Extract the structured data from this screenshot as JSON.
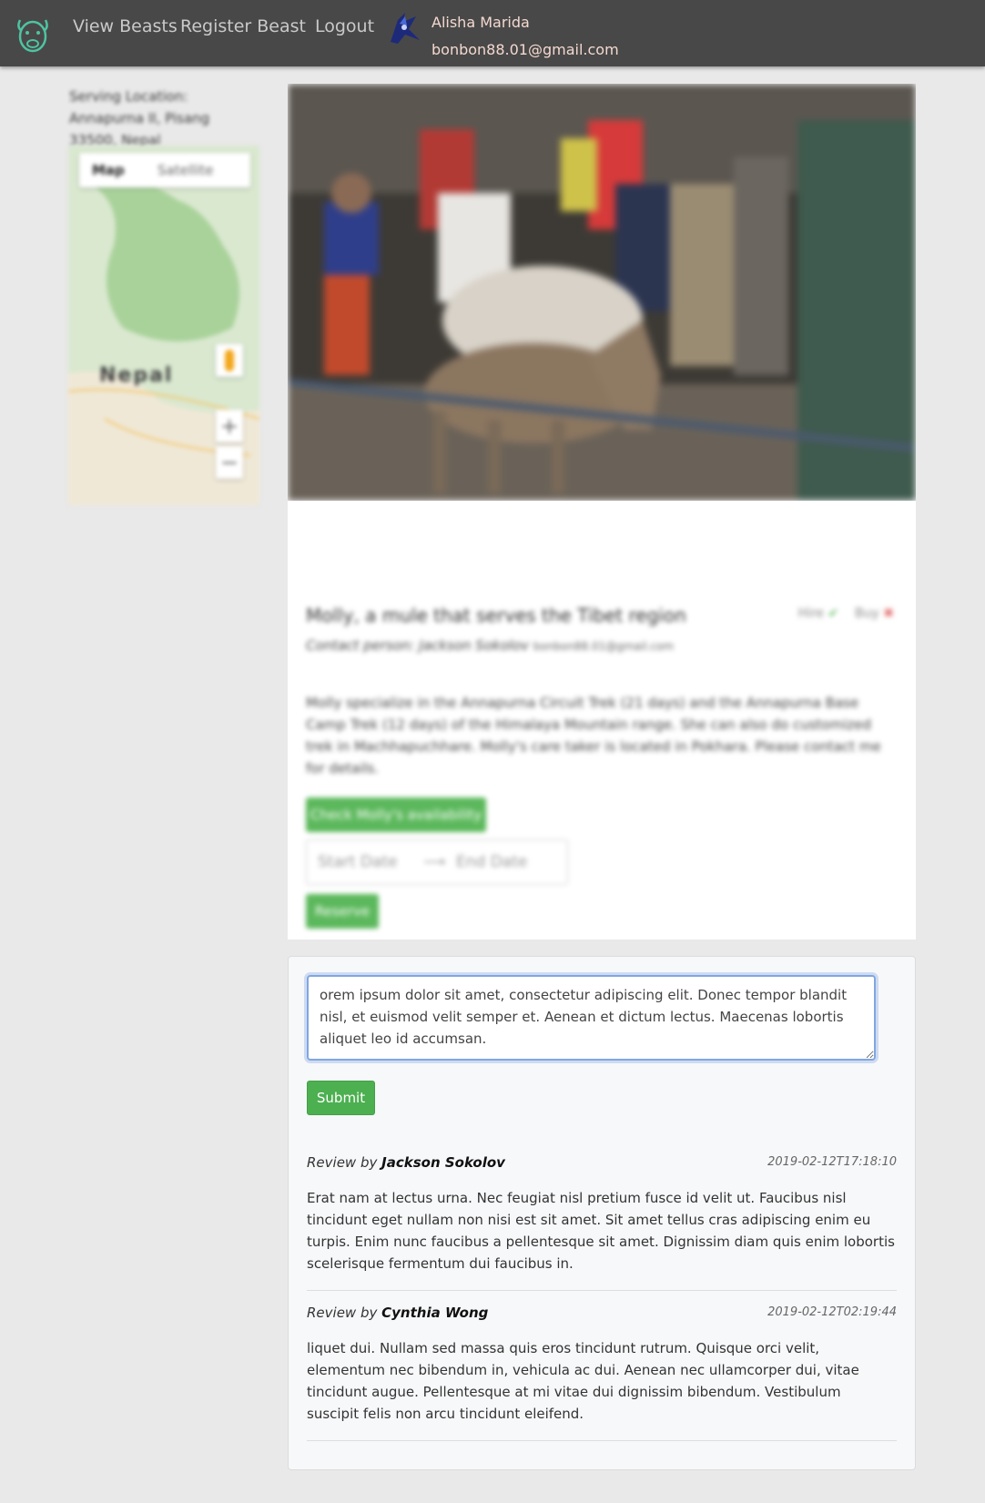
{
  "nav": {
    "links": [
      "View Beasts",
      "Register Beast",
      "Logout"
    ],
    "user": {
      "name": "Alisha Marida",
      "email": "bonbon88.01@gmail.com"
    }
  },
  "sidebar": {
    "location": "Serving Location: Annapurna II, Pisang 33500, Nepal",
    "map": {
      "tabs": [
        "Map",
        "Satellite"
      ],
      "region_label": "Nepal",
      "zoom_in": "+",
      "zoom_out": "−"
    }
  },
  "beast": {
    "title": "Molly, a mule that serves the Tibet region",
    "hire_label": "Hire",
    "buy_label": "Buy",
    "contact_label": "Contact person: Jackson Sokolov",
    "contact_email": "bonbon88.01@gmail.com",
    "description": "Molly specialize in the Annapurna Circuit Trek (21 days) and the Annapurna Base Camp Trek (12 days) of the Himalaya Mountain range. She can also do customized trek in Machhapuchhare. Molly's care taker is located in Pokhara. Please contact me for details.",
    "availability_button": "Check Molly's availability",
    "start_date_placeholder": "Start Date",
    "end_date_placeholder": "End Date",
    "reserve_button": "Reserve"
  },
  "review_form": {
    "text": "orem ipsum dolor sit amet, consectetur adipiscing elit. Donec tempor blandit nisl, et euismod velit semper et. Aenean et dictum lectus. Maecenas lobortis aliquet leo id accumsan.",
    "submit_label": "Submit"
  },
  "reviews": [
    {
      "prefix": "Review by",
      "author": "Jackson Sokolov",
      "date": "2019-02-12T17:18:10",
      "body": "Erat nam at lectus urna. Nec feugiat nisl pretium fusce id velit ut. Faucibus nisl tincidunt eget nullam non nisi est sit amet. Sit amet tellus cras adipiscing enim eu turpis. Enim nunc faucibus a pellentesque sit amet. Dignissim diam quis enim lobortis scelerisque fermentum dui faucibus in."
    },
    {
      "prefix": "Review by",
      "author": "Cynthia Wong",
      "date": "2019-02-12T02:19:44",
      "body": "liquet dui. Nullam sed massa quis eros tincidunt rutrum. Quisque orci velit, elementum nec bibendum in, vehicula ac dui. Aenean nec ullamcorper dui, vitae tincidunt augue. Pellentesque at mi vitae dui dignissim bibendum. Vestibulum suscipit felis non arcu tincidunt eleifend."
    }
  ],
  "colors": {
    "navbar": "#484848",
    "accent_green": "#5cb85c",
    "logo_teal": "#4fc3a1"
  }
}
